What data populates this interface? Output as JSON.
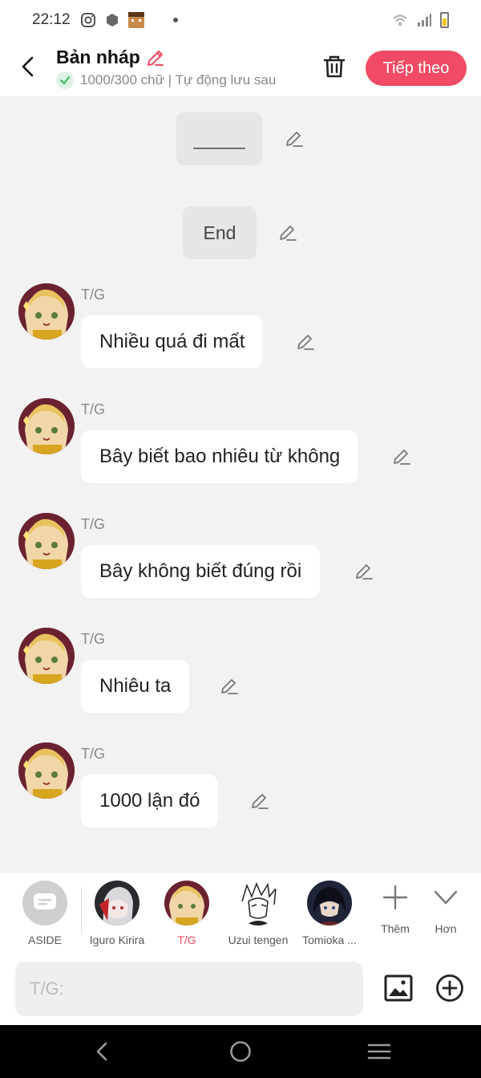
{
  "status_bar": {
    "time": "22:12",
    "icons": [
      "instagram-icon",
      "hexagon-icon",
      "pixel-avatar-icon",
      "dot-icon"
    ],
    "right_icons": [
      "wifi-icon",
      "signal-icon",
      "battery-icon"
    ]
  },
  "header": {
    "title": "Bản nháp",
    "subtitle": "1000/300 chữ | Tự động lưu sau",
    "next_label": "Tiếp theo"
  },
  "chat": {
    "narrations": [
      {
        "text": "_____"
      },
      {
        "text": "End"
      }
    ],
    "messages": [
      {
        "speaker": "T/G",
        "text": "Nhiều quá đi mất"
      },
      {
        "speaker": "T/G",
        "text": "Bây biết bao nhiêu từ không"
      },
      {
        "speaker": "T/G",
        "text": "Bây không biết đúng rồi"
      },
      {
        "speaker": "T/G",
        "text": "Nhiêu ta"
      },
      {
        "speaker": "T/G",
        "text": "1000 lận đó"
      }
    ]
  },
  "characters": {
    "items": [
      {
        "label": "ASIDE"
      },
      {
        "label": "Iguro Kirira"
      },
      {
        "label": "T/G",
        "selected": true
      },
      {
        "label": "Uzui tengen"
      },
      {
        "label": "Tomioka ..."
      }
    ],
    "add_label": "Thêm",
    "more_label": "Hơn",
    "accent": "#f04a64"
  },
  "input": {
    "placeholder": "T/G:"
  },
  "colors": {
    "accent": "#f04a64",
    "background": "#f2f2f2",
    "bubble": "#ffffff",
    "narration": "#e6e6e6"
  }
}
